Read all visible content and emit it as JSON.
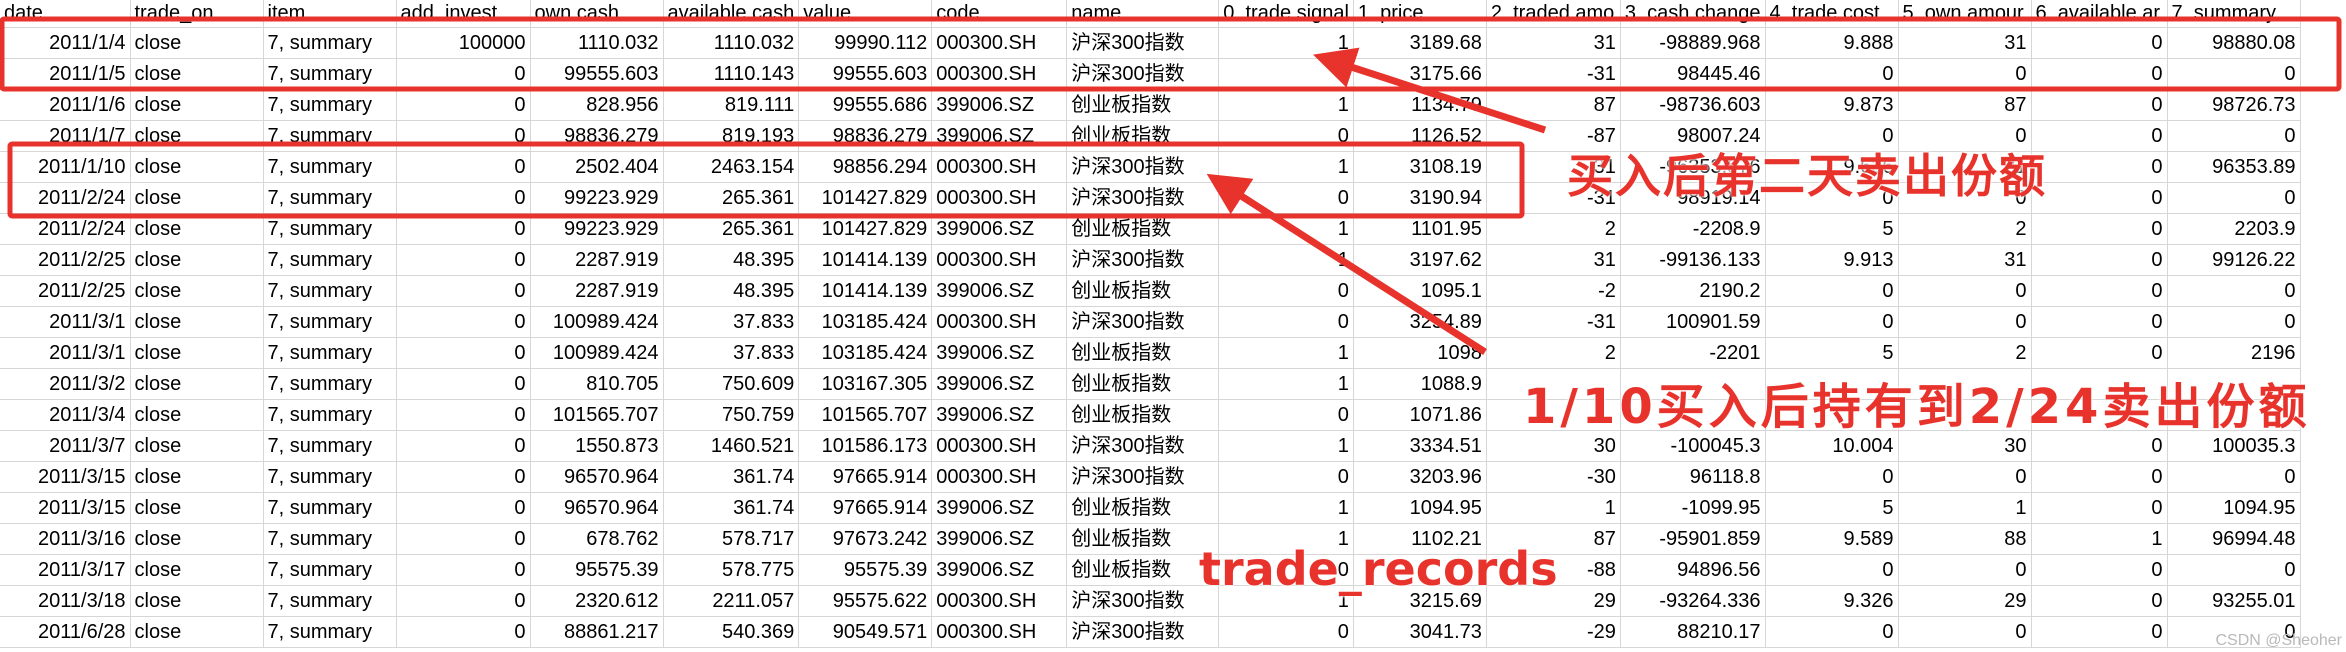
{
  "sheet": {
    "headers": [
      "date",
      "trade_on",
      "item",
      "add. invest",
      "own cash",
      "available cash",
      "value",
      "code",
      "name",
      "0, trade signal",
      "1, price",
      "2, traded amo",
      "3, cash change",
      "4, trade cost",
      "5, own amour",
      "6, available ar",
      "7, summary"
    ],
    "rows": [
      [
        "2011/1/4",
        "close",
        "7, summary",
        "100000",
        "1110.032",
        "1110.032",
        "99990.112",
        "000300.SH",
        "沪深300指数",
        "1",
        "3189.68",
        "31",
        "-98889.968",
        "9.888",
        "31",
        "0",
        "98880.08"
      ],
      [
        "2011/1/5",
        "close",
        "7, summary",
        "0",
        "99555.603",
        "1110.143",
        "99555.603",
        "000300.SH",
        "沪深300指数",
        "0",
        "3175.66",
        "-31",
        "98445.46",
        "0",
        "0",
        "0",
        "0"
      ],
      [
        "2011/1/6",
        "close",
        "7, summary",
        "0",
        "828.956",
        "819.111",
        "99555.686",
        "399006.SZ",
        "创业板指数",
        "1",
        "1134.79",
        "87",
        "-98736.603",
        "9.873",
        "87",
        "0",
        "98726.73"
      ],
      [
        "2011/1/7",
        "close",
        "7, summary",
        "0",
        "98836.279",
        "819.193",
        "98836.279",
        "399006.SZ",
        "创业板指数",
        "0",
        "1126.52",
        "-87",
        "98007.24",
        "0",
        "0",
        "0",
        "0"
      ],
      [
        "2011/1/10",
        "close",
        "7, summary",
        "0",
        "2502.404",
        "2463.154",
        "98856.294",
        "000300.SH",
        "沪深300指数",
        "1",
        "3108.19",
        "31",
        "-96353.876",
        "9.636",
        "31",
        "0",
        "96353.89"
      ],
      [
        "2011/2/24",
        "close",
        "7, summary",
        "0",
        "99223.929",
        "265.361",
        "101427.829",
        "000300.SH",
        "沪深300指数",
        "0",
        "3190.94",
        "-31",
        "98919.14",
        "0",
        "0",
        "0",
        "0"
      ],
      [
        "2011/2/24",
        "close",
        "7, summary",
        "0",
        "99223.929",
        "265.361",
        "101427.829",
        "399006.SZ",
        "创业板指数",
        "1",
        "1101.95",
        "2",
        "-2208.9",
        "5",
        "2",
        "0",
        "2203.9"
      ],
      [
        "2011/2/25",
        "close",
        "7, summary",
        "0",
        "2287.919",
        "48.395",
        "101414.139",
        "000300.SH",
        "沪深300指数",
        "1",
        "3197.62",
        "31",
        "-99136.133",
        "9.913",
        "31",
        "0",
        "99126.22"
      ],
      [
        "2011/2/25",
        "close",
        "7, summary",
        "0",
        "2287.919",
        "48.395",
        "101414.139",
        "399006.SZ",
        "创业板指数",
        "0",
        "1095.1",
        "-2",
        "2190.2",
        "0",
        "0",
        "0",
        "0"
      ],
      [
        "2011/3/1",
        "close",
        "7, summary",
        "0",
        "100989.424",
        "37.833",
        "103185.424",
        "000300.SH",
        "沪深300指数",
        "0",
        "3254.89",
        "-31",
        "100901.59",
        "0",
        "0",
        "0",
        "0"
      ],
      [
        "2011/3/1",
        "close",
        "7, summary",
        "0",
        "100989.424",
        "37.833",
        "103185.424",
        "399006.SZ",
        "创业板指数",
        "1",
        "1098",
        "2",
        "-2201",
        "5",
        "2",
        "0",
        "2196"
      ],
      [
        "2011/3/2",
        "close",
        "7, summary",
        "0",
        "810.705",
        "750.609",
        "103167.305",
        "399006.SZ",
        "创业板指数",
        "1",
        "1088.9",
        "",
        "",
        "",
        "",
        "",
        ""
      ],
      [
        "2011/3/4",
        "close",
        "7, summary",
        "0",
        "101565.707",
        "750.759",
        "101565.707",
        "399006.SZ",
        "创业板指数",
        "0",
        "1071.86",
        "",
        "",
        "",
        "",
        "",
        ""
      ],
      [
        "2011/3/7",
        "close",
        "7, summary",
        "0",
        "1550.873",
        "1460.521",
        "101586.173",
        "000300.SH",
        "沪深300指数",
        "1",
        "3334.51",
        "30",
        "-100045.3",
        "10.004",
        "30",
        "0",
        "100035.3"
      ],
      [
        "2011/3/15",
        "close",
        "7, summary",
        "0",
        "96570.964",
        "361.74",
        "97665.914",
        "000300.SH",
        "沪深300指数",
        "0",
        "3203.96",
        "-30",
        "96118.8",
        "0",
        "0",
        "0",
        "0"
      ],
      [
        "2011/3/15",
        "close",
        "7, summary",
        "0",
        "96570.964",
        "361.74",
        "97665.914",
        "399006.SZ",
        "创业板指数",
        "1",
        "1094.95",
        "1",
        "-1099.95",
        "5",
        "1",
        "0",
        "1094.95"
      ],
      [
        "2011/3/16",
        "close",
        "7, summary",
        "0",
        "678.762",
        "578.717",
        "97673.242",
        "399006.SZ",
        "创业板指数",
        "1",
        "1102.21",
        "87",
        "-95901.859",
        "9.589",
        "88",
        "1",
        "96994.48"
      ],
      [
        "2011/3/17",
        "close",
        "7, summary",
        "0",
        "95575.39",
        "578.775",
        "95575.39",
        "399006.SZ",
        "创业板指数",
        "0",
        "",
        "-88",
        "94896.56",
        "0",
        "0",
        "0",
        "0"
      ],
      [
        "2011/3/18",
        "close",
        "7, summary",
        "0",
        "2320.612",
        "2211.057",
        "95575.622",
        "000300.SH",
        "沪深300指数",
        "1",
        "3215.69",
        "29",
        "-93264.336",
        "9.326",
        "29",
        "0",
        "93255.01"
      ],
      [
        "2011/6/28",
        "close",
        "7, summary",
        "0",
        "88861.217",
        "540.369",
        "90549.571",
        "000300.SH",
        "沪深300指数",
        "0",
        "3041.73",
        "-29",
        "88210.17",
        "0",
        "0",
        "0",
        "0"
      ]
    ]
  },
  "annotations": {
    "label_next_day": "买入后第二天卖出份额",
    "label_hold": "1/10买入后持有到2/24卖出份额",
    "label_records": "trade_records",
    "highlight_color": "#e8332c"
  },
  "watermark": "CSDN @Sheoher"
}
